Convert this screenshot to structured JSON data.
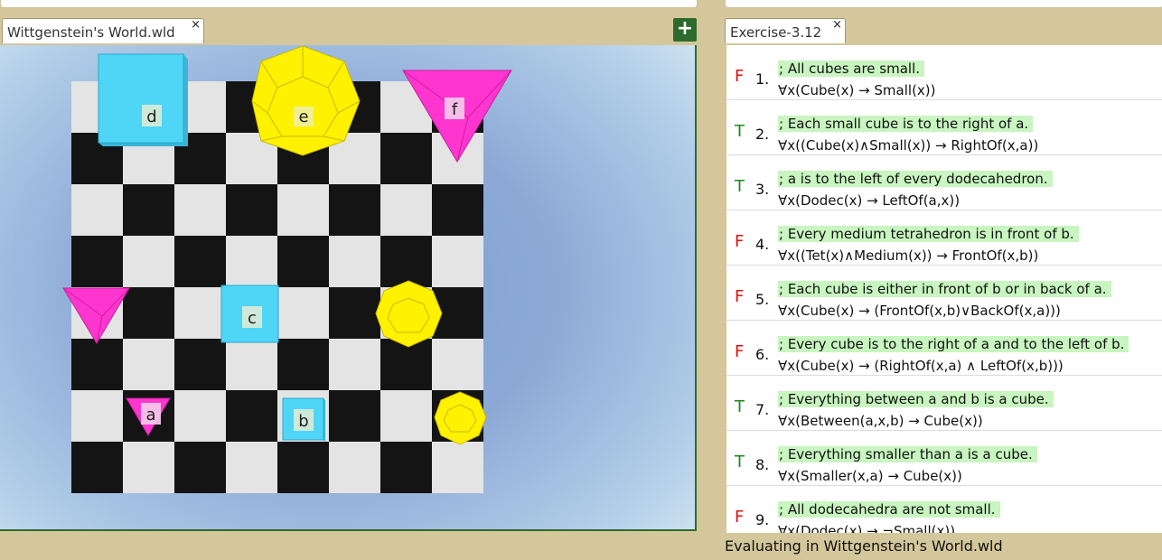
{
  "world_tab": {
    "label": "Wittgenstein's World.wld",
    "close": "×"
  },
  "add_button": "+",
  "exercise_tab": {
    "label": "Exercise-3.12",
    "close": "×"
  },
  "blocks": [
    {
      "label": "d",
      "shape": "cube",
      "size": "large",
      "color": "#4fd6f7"
    },
    {
      "label": "e",
      "shape": "dodecahedron",
      "size": "large",
      "color": "#fff200"
    },
    {
      "label": "f",
      "shape": "tetrahedron",
      "size": "large",
      "color": "#ff35d0"
    },
    {
      "label": "c",
      "shape": "cube",
      "size": "medium",
      "color": "#4fd6f7"
    },
    {
      "label": "b",
      "shape": "cube",
      "size": "small",
      "color": "#4fd6f7"
    },
    {
      "label": "a",
      "shape": "tetrahedron",
      "size": "small",
      "color": "#ff35d0"
    }
  ],
  "sentences": [
    {
      "value": "F",
      "number": "1.",
      "comment": "; All cubes are small.",
      "formula": "∀x(Cube(x) → Small(x))"
    },
    {
      "value": "T",
      "number": "2.",
      "comment": "; Each small cube is to the right of a.",
      "formula": "∀x((Cube(x)∧Small(x)) → RightOf(x,a))"
    },
    {
      "value": "T",
      "number": "3.",
      "comment": "; a is to the left of every dodecahedron.",
      "formula": "∀x(Dodec(x) → LeftOf(a,x))"
    },
    {
      "value": "F",
      "number": "4.",
      "comment": "; Every medium tetrahedron is in front of b.",
      "formula": "∀x((Tet(x)∧Medium(x)) → FrontOf(x,b))"
    },
    {
      "value": "F",
      "number": "5.",
      "comment": "; Each cube is either in front of b or in back of a.",
      "formula": "∀x(Cube(x) → (FrontOf(x,b)∨BackOf(x,a)))"
    },
    {
      "value": "F",
      "number": "6.",
      "comment": "; Every cube is to the right of a and to the left of b.",
      "formula": "∀x(Cube(x) → (RightOf(x,a) ∧ LeftOf(x,b)))"
    },
    {
      "value": "T",
      "number": "7.",
      "comment": "; Everything between a and b is a cube.",
      "formula": "∀x(Between(a,x,b) → Cube(x))"
    },
    {
      "value": "T",
      "number": "8.",
      "comment": "; Everything smaller than a is a cube.",
      "formula": "∀x(Smaller(x,a) → Cube(x))"
    },
    {
      "value": "F",
      "number": "9.",
      "comment": "; All dodecahedra are not small.",
      "formula": "∀x(Dodec(x) → ¬Small(x))"
    }
  ],
  "status": "Evaluating in Wittgenstein's World.wld"
}
